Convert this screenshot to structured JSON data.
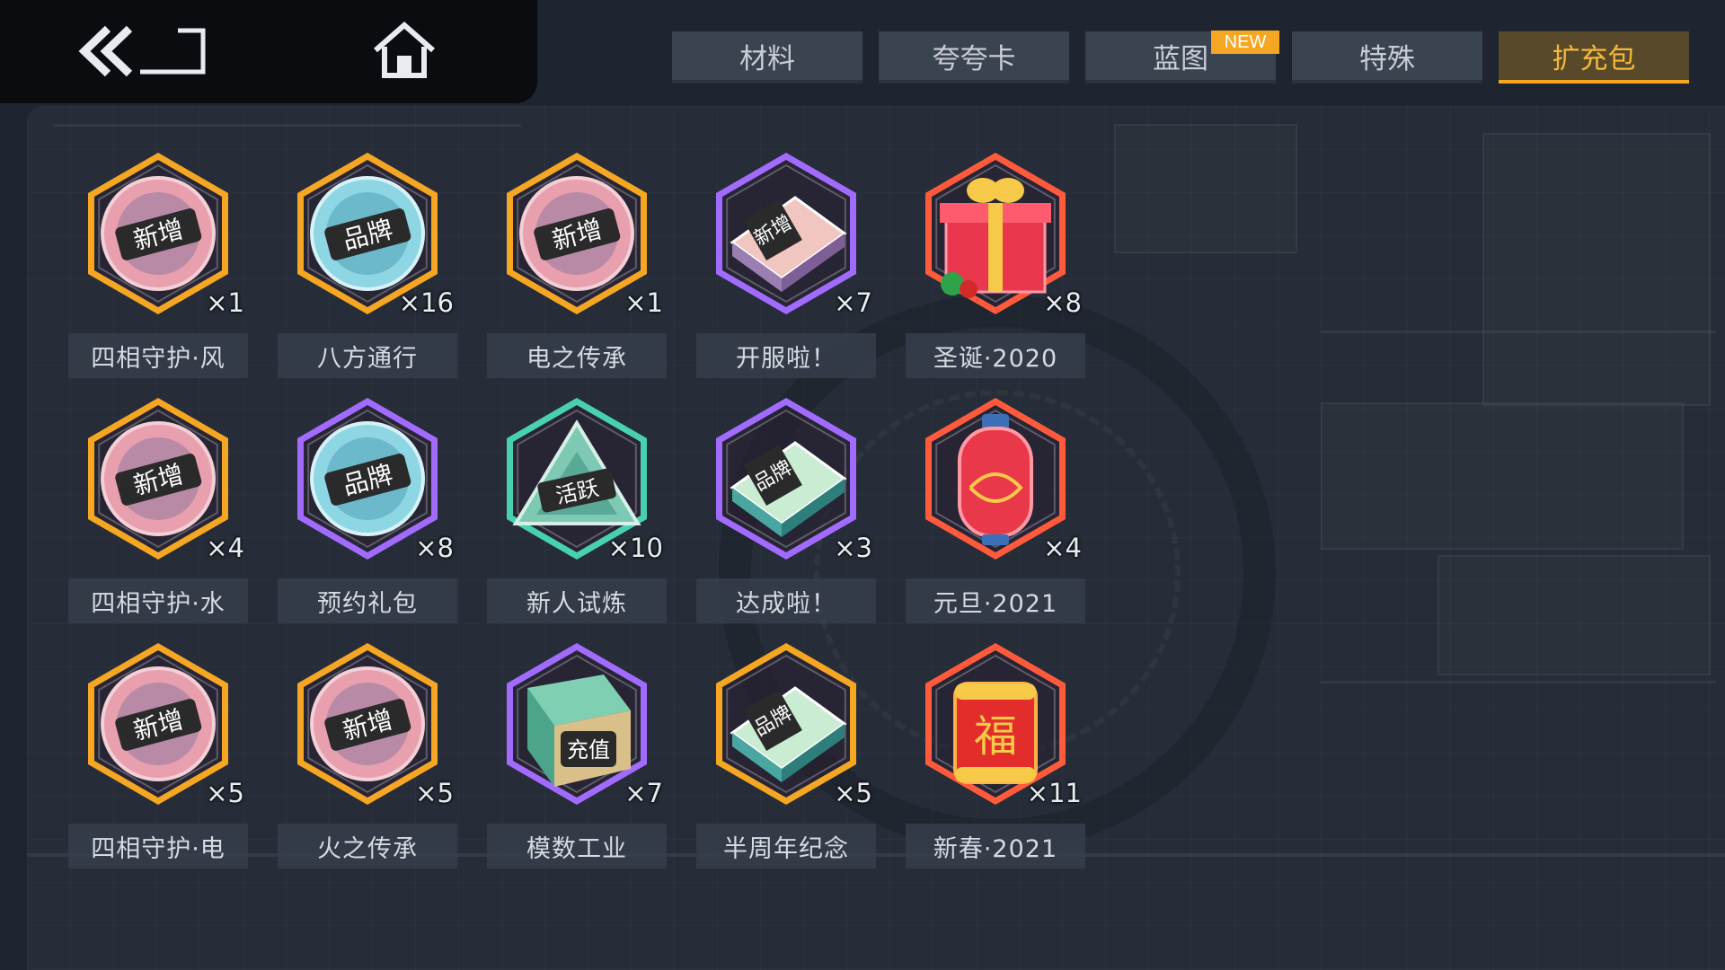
{
  "nav": {
    "back_icon": "double-chevron-left-icon",
    "home_icon": "home-icon"
  },
  "tabs": [
    {
      "label": "材料",
      "active": false
    },
    {
      "label": "夸夸卡",
      "active": false
    },
    {
      "label": "蓝图",
      "active": false,
      "badge": "NEW"
    },
    {
      "label": "特殊",
      "active": false
    },
    {
      "label": "扩充包",
      "active": true
    }
  ],
  "colors": {
    "accent": "#f5a623",
    "tab_bg": "#3a4350",
    "panel_bg": "#262d38"
  },
  "items": [
    {
      "name": "四相守护·风",
      "count": "×1",
      "icon": "badge-xinzeng",
      "badge_text": "新增",
      "rarity": "orange"
    },
    {
      "name": "八方通行",
      "count": "×16",
      "icon": "badge-pinpai",
      "badge_text": "品牌",
      "rarity": "orange"
    },
    {
      "name": "电之传承",
      "count": "×1",
      "icon": "badge-xinzeng",
      "badge_text": "新增",
      "rarity": "orange"
    },
    {
      "name": "开服啦！",
      "count": "×7",
      "icon": "box-xinzeng",
      "badge_text": "新增",
      "rarity": "purple"
    },
    {
      "name": "圣诞·2020",
      "count": "×8",
      "icon": "gift-box",
      "badge_text": "",
      "rarity": "red"
    },
    {
      "name": "四相守护·水",
      "count": "×4",
      "icon": "badge-xinzeng",
      "badge_text": "新增",
      "rarity": "orange"
    },
    {
      "name": "预约礼包",
      "count": "×8",
      "icon": "badge-pinpai",
      "badge_text": "品牌",
      "rarity": "purple"
    },
    {
      "name": "新人试炼",
      "count": "×10",
      "icon": "triangle-huoyue",
      "badge_text": "活跃",
      "rarity": "teal"
    },
    {
      "name": "达成啦！",
      "count": "×3",
      "icon": "box-pinpai",
      "badge_text": "品牌",
      "rarity": "purple"
    },
    {
      "name": "元旦·2021",
      "count": "×4",
      "icon": "lantern",
      "badge_text": "",
      "rarity": "red"
    },
    {
      "name": "四相守护·电",
      "count": "×5",
      "icon": "badge-xinzeng",
      "badge_text": "新增",
      "rarity": "orange"
    },
    {
      "name": "火之传承",
      "count": "×5",
      "icon": "badge-xinzeng",
      "badge_text": "新增",
      "rarity": "orange"
    },
    {
      "name": "模数工业",
      "count": "×7",
      "icon": "cube-chongzhi",
      "badge_text": "充值",
      "rarity": "purple"
    },
    {
      "name": "半周年纪念",
      "count": "×5",
      "icon": "box-pinpai",
      "badge_text": "品牌",
      "rarity": "orange"
    },
    {
      "name": "新春·2021",
      "count": "×11",
      "icon": "firecracker-fu",
      "badge_text": "福",
      "rarity": "red"
    }
  ]
}
